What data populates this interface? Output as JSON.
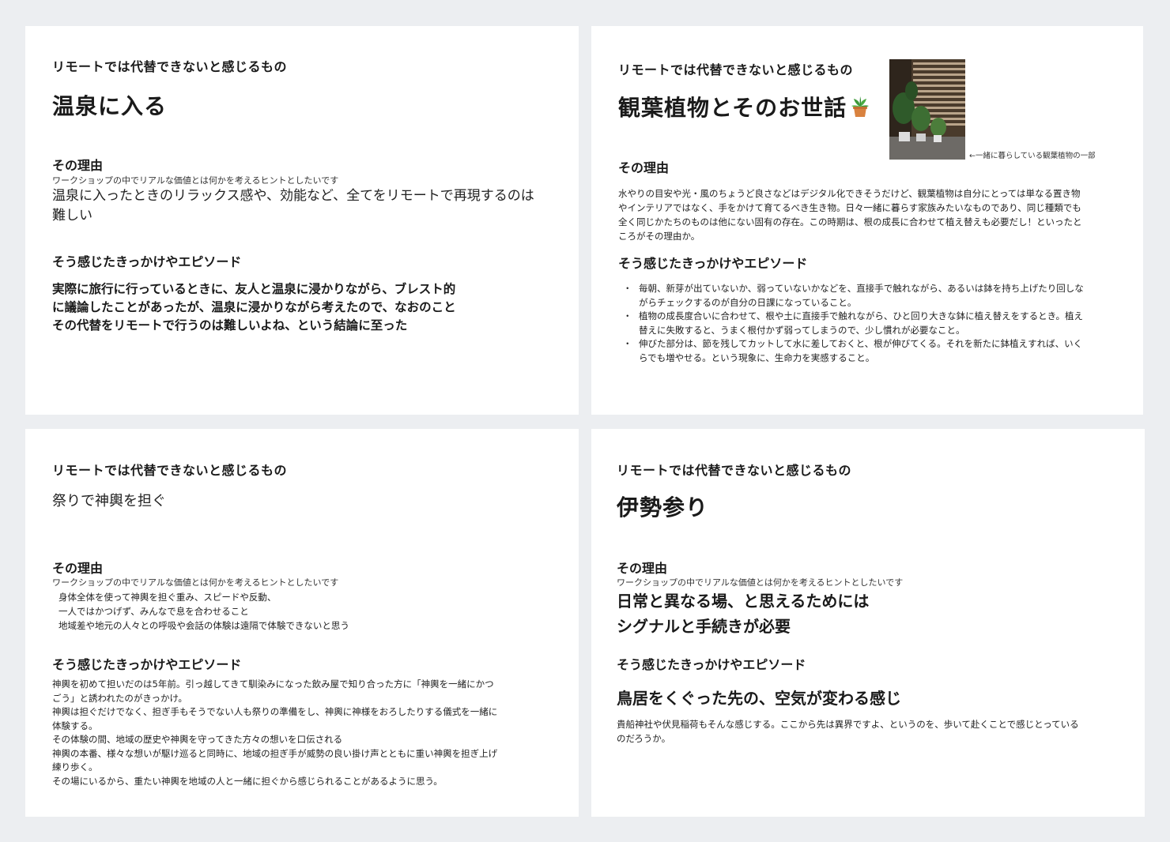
{
  "cards": [
    {
      "kicker": "リモートでは代替できないと感じるもの",
      "title": "温泉に入る",
      "reason_heading": "その理由",
      "reason_hint": "ワークショップの中でリアルな価値とは何かを考えるヒントとしたいです",
      "reason_lines": [
        "温泉に入ったときのリラックス感や、効能など、全てをリモートで再現するのは",
        "難しい"
      ],
      "episode_heading": "そう感じたきっかけやエピソード",
      "episode_lines": [
        "実際に旅行に行っているときに、友人と温泉に浸かりながら、ブレスト的",
        "に議論したことがあったが、温泉に浸かりながら考えたので、なおのこと",
        "その代替をリモートで行うのは難しいよね、という結論に至った"
      ]
    },
    {
      "kicker": "リモートでは代替できないと感じるもの",
      "title": "観葉植物とそのお世話",
      "title_icon": "potted-plant-icon",
      "photo_caption": "←一緒に暮らしている観葉植物の一部",
      "reason_heading": "その理由",
      "reason_lines": [
        "水やりの目安や光・風のちょうど良さなどはデジタル化できそうだけど、観葉植物は自分にとっては単なる置き物",
        "やインテリアではなく、手をかけて育てるべき生き物。日々一緒に暮らす家族みたいなものであり、同じ種類でも",
        "全く同じかたちのものは他にない固有の存在。この時期は、根の成長に合わせて植え替えも必要だし！といったと",
        "ころがその理由か。"
      ],
      "episode_heading": "そう感じたきっかけやエピソード",
      "episode_bullets": [
        [
          "毎朝、新芽が出ていないか、弱っていないかなどを、直接手で触れながら、あるいは鉢を持ち上げたり回しな",
          "がらチェックするのが自分の日課になっていること。"
        ],
        [
          "植物の成長度合いに合わせて、根や土に直接手で触れながら、ひと回り大きな鉢に植え替えをするとき。植え",
          "替えに失敗すると、うまく根付かず弱ってしまうので、少し慣れが必要なこと。"
        ],
        [
          "伸びた部分は、節を残してカットして水に差しておくと、根が伸びてくる。それを新たに鉢植えすれば、いく",
          "らでも増やせる。という現象に、生命力を実感すること。"
        ]
      ]
    },
    {
      "kicker": "リモートでは代替できないと感じるもの",
      "title": "祭りで神輿を担ぐ",
      "reason_heading": "その理由",
      "reason_hint": "ワークショップの中でリアルな価値とは何かを考えるヒントとしたいです",
      "reason_lines": [
        "身体全体を使って神輿を担ぐ重み、スピードや反動、",
        "一人ではかつげず、みんなで息を合わせること",
        "地域差や地元の人々との呼吸や会話の体験は遠隔で体験できないと思う"
      ],
      "episode_heading": "そう感じたきっかけやエピソード",
      "episode_lines": [
        "神輿を初めて担いだのは5年前。引っ越してきて馴染みになった飲み屋で知り合った方に「神輿を一緒にかつ",
        "ごう」と誘われたのがきっかけ。",
        "神輿は担ぐだけでなく、担ぎ手もそうでない人も祭りの準備をし、神輿に神様をおろしたりする儀式を一緒に",
        "体験する。",
        "その体験の間、地域の歴史や神輿を守ってきた方々の想いを口伝される",
        "神輿の本番、様々な想いが駆け巡ると同時に、地域の担ぎ手が威勢の良い掛け声とともに重い神輿を担ぎ上げ",
        "練り歩く。",
        "その場にいるから、重たい神輿を地域の人と一緒に担ぐから感じられることがあるように思う。"
      ]
    },
    {
      "kicker": "リモートでは代替できないと感じるもの",
      "title": "伊勢参り",
      "reason_heading": "その理由",
      "reason_hint": "ワークショップの中でリアルな価値とは何かを考えるヒントとしたいです",
      "reason_lines": [
        "日常と異なる場、と思えるためには",
        "シグナルと手続きが必要"
      ],
      "episode_heading": "そう感じたきっかけやエピソード",
      "episode_big": "鳥居をくぐった先の、空気が変わる感じ",
      "episode_lines": [
        "貴船神社や伏見稲荷もそんな感じする。ここから先は異界ですよ、というのを、歩いて赴くことで感じとっている",
        "のだろうか。"
      ]
    }
  ]
}
